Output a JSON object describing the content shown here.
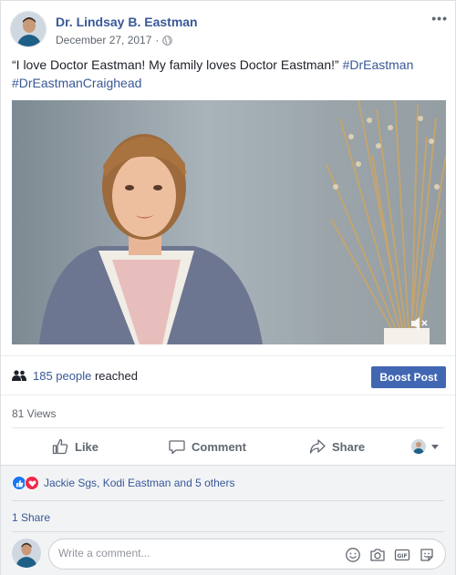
{
  "post": {
    "author": "Dr. Lindsay B. Eastman",
    "date": "December 27, 2017",
    "privacy_dot": "·",
    "more_label": "•••",
    "text_quote": "“I love Doctor Eastman! My family loves Doctor Eastman!”",
    "hashtag1": "#DrEastman",
    "hashtag2": "#DrEastmanCraighead"
  },
  "reach": {
    "count": "185 people",
    "suffix": "reached",
    "boost_label": "Boost Post"
  },
  "views": "81 Views",
  "actions": {
    "like": "Like",
    "comment": "Comment",
    "share": "Share"
  },
  "reactions": {
    "names": "Jackie Sgs, Kodi Eastman and 5 others"
  },
  "shares": "1 Share",
  "comment": {
    "placeholder": "Write a comment..."
  },
  "colors": {
    "link": "#385898",
    "boost": "#4267b2",
    "like": "#1877f2",
    "love": "#f0284a"
  },
  "icons": [
    "globe-icon",
    "more-icon",
    "mute-icon",
    "people-icon",
    "like-icon",
    "comment-icon",
    "share-icon",
    "caret-down-icon",
    "like-reaction-icon",
    "love-reaction-icon",
    "emoji-icon",
    "camera-icon",
    "gif-icon",
    "sticker-icon"
  ]
}
